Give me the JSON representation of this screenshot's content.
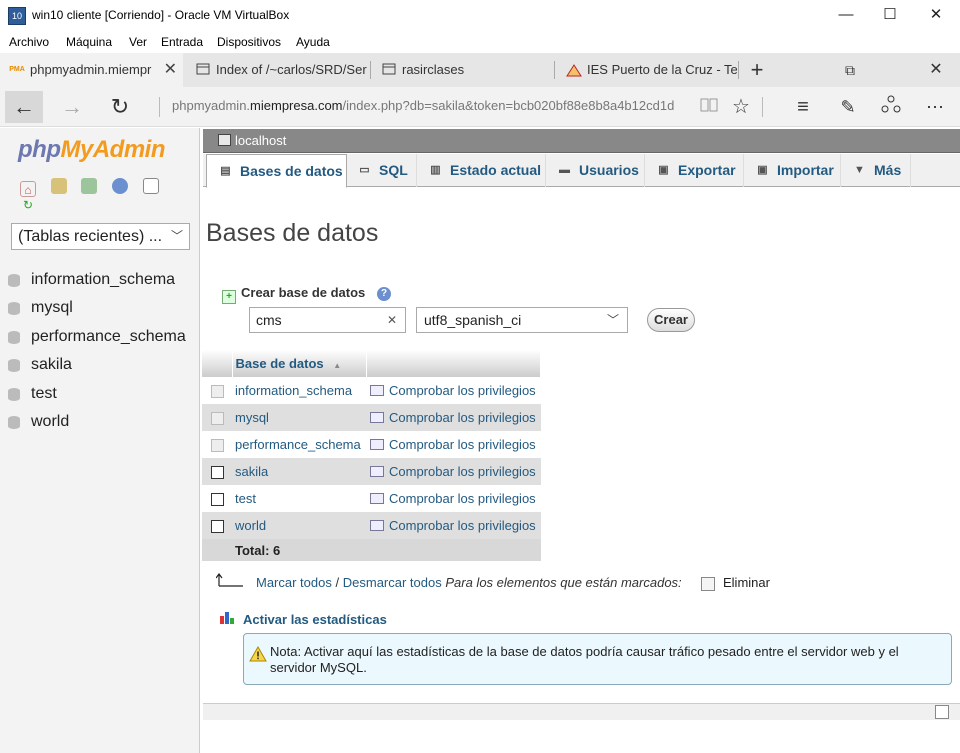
{
  "window": {
    "title": "win10 cliente [Corriendo] - Oracle VM VirtualBox",
    "icon_text": "10",
    "controls": {
      "minimize": "—",
      "maximize": "☐",
      "close": "✕"
    },
    "menu": [
      "Archivo",
      "Máquina",
      "Ver",
      "Entrada",
      "Dispositivos",
      "Ayuda"
    ]
  },
  "browser": {
    "tabs": [
      {
        "label": "phpmyadmin.miempr",
        "icon": "pma-favicon",
        "active": true
      },
      {
        "label": "Index of /~carlos/SRD/Ser",
        "icon": "page-icon"
      },
      {
        "label": "rasirclases",
        "icon": "page-icon"
      },
      {
        "label": "IES Puerto de la Cruz - Tel",
        "icon": "school-icon"
      }
    ],
    "tab_close": "✕",
    "new_tab": "+",
    "url_prefix": "phpmyadmin.",
    "url_domain": "miempresa.com",
    "url_path": "/index.php?db=sakila&token=bcb020bf88e8b8a4b12cd1d",
    "nav": {
      "back": "←",
      "forward": "→",
      "refresh": "↻"
    },
    "actions": {
      "reading": "📖",
      "favorite": "☆",
      "hub": "≡",
      "notes": "✎",
      "share": "⇪",
      "more": "⋯"
    },
    "pma_favicon_text": "PMA"
  },
  "left": {
    "logo_php": "php",
    "logo_myadmin": "MyAdmin",
    "recent_select": "(Tablas recientes) ...",
    "databases": [
      "information_schema",
      "mysql",
      "performance_schema",
      "sakila",
      "test",
      "world"
    ]
  },
  "main": {
    "server": "localhost",
    "tabs": [
      {
        "label": "Bases de datos",
        "icon": "database-icon"
      },
      {
        "label": "SQL",
        "icon": "sql-icon"
      },
      {
        "label": "Estado actual",
        "icon": "status-icon"
      },
      {
        "label": "Usuarios",
        "icon": "users-icon"
      },
      {
        "label": "Exportar",
        "icon": "export-icon"
      },
      {
        "label": "Importar",
        "icon": "import-icon"
      },
      {
        "label": "Más",
        "icon": "more-icon"
      }
    ],
    "heading": "Bases de datos",
    "create_label": "Crear base de datos",
    "new_db_name": "cms",
    "collation": "utf8_spanish_ci",
    "create_button": "Crear",
    "table": {
      "header": "Base de datos",
      "sort_indicator": "▲",
      "rows": [
        {
          "name": "information_schema",
          "action": "Comprobar los privilegios",
          "disabled": true
        },
        {
          "name": "mysql",
          "action": "Comprobar los privilegios",
          "disabled": true
        },
        {
          "name": "performance_schema",
          "action": "Comprobar los privilegios",
          "disabled": true
        },
        {
          "name": "sakila",
          "action": "Comprobar los privilegios",
          "disabled": false
        },
        {
          "name": "test",
          "action": "Comprobar los privilegios",
          "disabled": false
        },
        {
          "name": "world",
          "action": "Comprobar los privilegios",
          "disabled": false
        }
      ],
      "total": "Total: 6"
    },
    "mark_all": "Marcar todos",
    "separator": "/",
    "unmark_all": "Desmarcar todos",
    "with_selected": "Para los elementos que están marcados:",
    "delete": "Eliminar",
    "enable_stats": "Activar las estadísticas",
    "note": "Nota: Activar aquí las estadísticas de la base de datos podría causar tráfico pesado entre el servidor web y el servidor MySQL."
  }
}
